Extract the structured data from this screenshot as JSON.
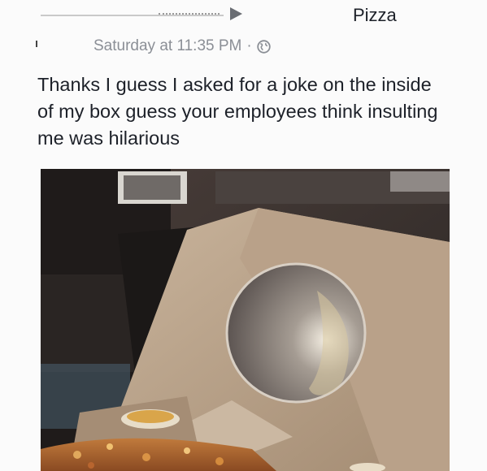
{
  "post": {
    "page_name": "Pizza",
    "timestamp": "Saturday at 11:35 PM",
    "separator": "·",
    "privacy_icon": "globe-icon",
    "text": "Thanks I guess I asked for a joke on the inside of my box guess your employees think insulting me was hilarious",
    "photo_icon": "pizza-box-photo"
  }
}
